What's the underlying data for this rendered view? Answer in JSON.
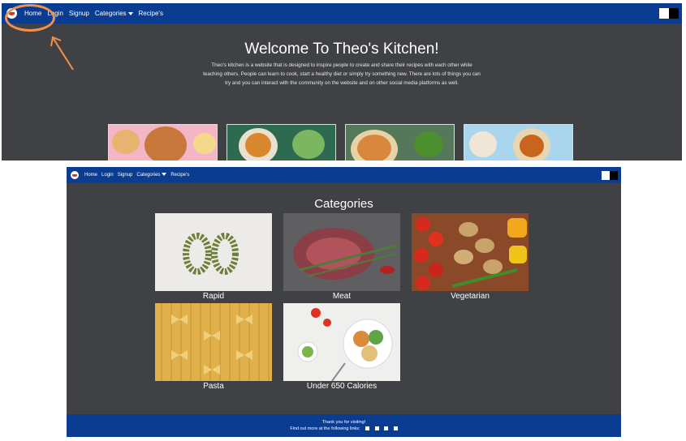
{
  "nav": {
    "items": [
      {
        "label": "Home"
      },
      {
        "label": "Login"
      },
      {
        "label": "Signup"
      },
      {
        "label": "Categories"
      },
      {
        "label": "Recipe's"
      }
    ]
  },
  "hero": {
    "title": "Welcome To Theo's Kitchen!",
    "text": "Theo's kitchen is a website that is designed to inspire people to create and share their recipes with each other while teaching others. People can learn to cook, start a healthy diet or simply try something new. There are lots of things you can try and you can interact with the community on the website and on other social media platforms as well."
  },
  "categories": {
    "title": "Categories",
    "items": [
      {
        "label": "Rapid"
      },
      {
        "label": "Meat"
      },
      {
        "label": "Vegetarian"
      },
      {
        "label": "Pasta"
      },
      {
        "label": "Under 650 Calories"
      }
    ]
  },
  "footer": {
    "line1": "Thank you for visiting!",
    "line2": "Find out more at the following links:"
  },
  "colors": {
    "navbar": "#0a3d91",
    "background": "#3f4145",
    "annotation": "#f0924e"
  },
  "icons": {
    "logo": "kitchen-logo-icon",
    "social": [
      "facebook-icon",
      "twitter-icon",
      "instagram-icon",
      "youtube-icon"
    ]
  }
}
